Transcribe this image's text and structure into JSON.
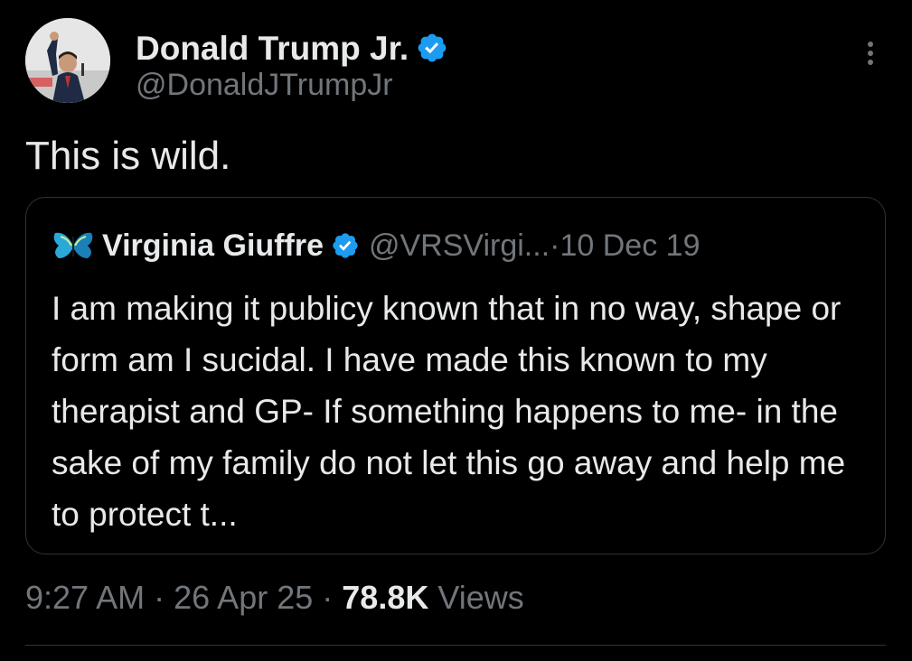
{
  "author": {
    "display_name": "Donald Trump Jr.",
    "handle": "@DonaldJTrumpJr",
    "verified": true
  },
  "tweet": {
    "text": "This is wild."
  },
  "quoted_tweet": {
    "display_name": "Virginia Giuffre",
    "handle": "@VRSVirgi...",
    "separator": "·",
    "date": "10 Dec 19",
    "verified": true,
    "text": "I am making it publicy known that in no way, shape or form am I sucidal. I have made this known to my therapist and GP- If something happens to me- in the sake of my family do not let this go away and help me to protect t..."
  },
  "meta": {
    "time": "9:27 AM",
    "sep1": "·",
    "date": "26 Apr 25",
    "sep2": "·",
    "views_count": "78.8K",
    "views_label": "Views"
  },
  "colors": {
    "background": "#000000",
    "text_primary": "#e7e9ea",
    "text_secondary": "#71767b",
    "verified_blue": "#1d9bf0",
    "border": "#2f3336"
  }
}
